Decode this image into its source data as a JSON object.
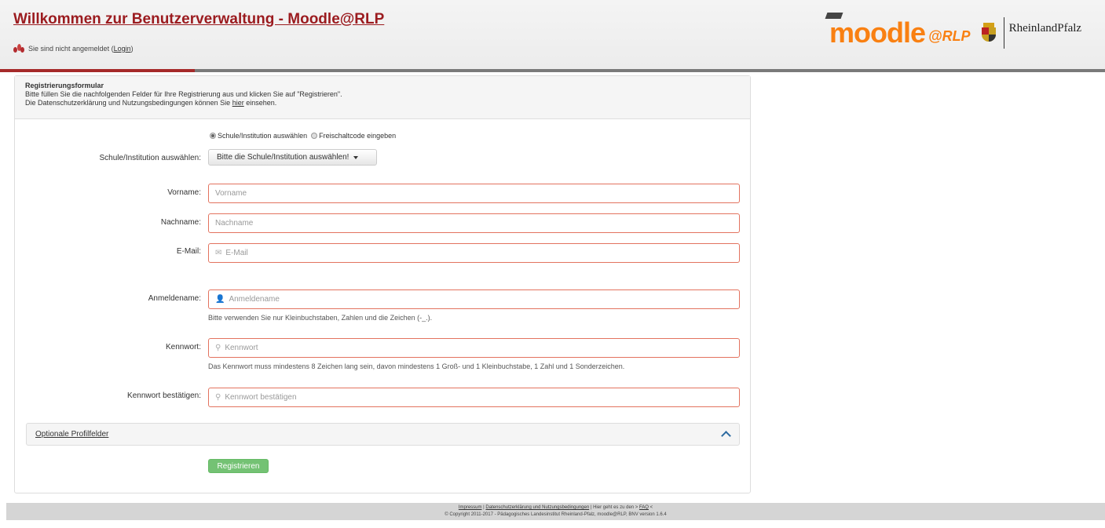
{
  "header": {
    "title": "Willkommen zur Benutzerverwaltung - Moodle@RLP",
    "login_prefix": "Sie sind nicht angemeldet (",
    "login_link": "Login",
    "login_suffix": ")",
    "logo_main": "moodle",
    "logo_sub": "@RLP",
    "state_name": "RheinlandPfalz"
  },
  "form": {
    "heading": "Registrierungsformular",
    "intro_line1": "Bitte füllen Sie die nachfolgenden Felder für Ihre Registrierung aus und klicken Sie auf \"Registrieren\".",
    "intro_line2_prefix": "Die Datenschutzerklärung und Nutzungsbedingungen können Sie ",
    "intro_link": "hier",
    "intro_line2_suffix": " einsehen.",
    "radio_school": "Schule/Institution auswählen",
    "radio_code": "Freischaltcode eingeben",
    "school_label": "Schule/Institution auswählen:",
    "school_select": "Bitte die Schule/Institution auswählen!",
    "firstname_label": "Vorname:",
    "firstname_placeholder": "Vorname",
    "lastname_label": "Nachname:",
    "lastname_placeholder": "Nachname",
    "email_label": "E-Mail:",
    "email_placeholder": "E-Mail",
    "username_label": "Anmeldename:",
    "username_placeholder": "Anmeldename",
    "username_help": "Bitte verwenden Sie nur Kleinbuchstaben, Zahlen und die Zeichen (-_.).",
    "password_label": "Kennwort:",
    "password_placeholder": "Kennwort",
    "password_help": "Das Kennwort muss mindestens 8 Zeichen lang sein, davon mindestens 1 Groß- und 1 Kleinbuchstabe, 1 Zahl und 1 Sonderzeichen.",
    "confirm_label": "Kennwort bestätigen:",
    "confirm_placeholder": "Kennwort bestätigen",
    "optional_fields": "Optionale Profilfelder",
    "submit_label": "Registrieren"
  },
  "footer": {
    "impressum": "Impressum",
    "separator": " | ",
    "privacy": "Datenschutzerklärung und Nutzungsbedingungen",
    "faq_prefix": " | Hier geht es zu den > ",
    "faq": "FAQ",
    "faq_suffix": " <",
    "copyright": "© Copyright 2011-2017 - Pädagogisches Landesinstitut Rheinland-Pfalz, moodle@RLP, BNV version 1.6.4"
  },
  "colors": {
    "title": "#9b1b1f",
    "accent_orange": "#f98012",
    "input_border": "#e3735f",
    "submit": "#5cb85c"
  }
}
